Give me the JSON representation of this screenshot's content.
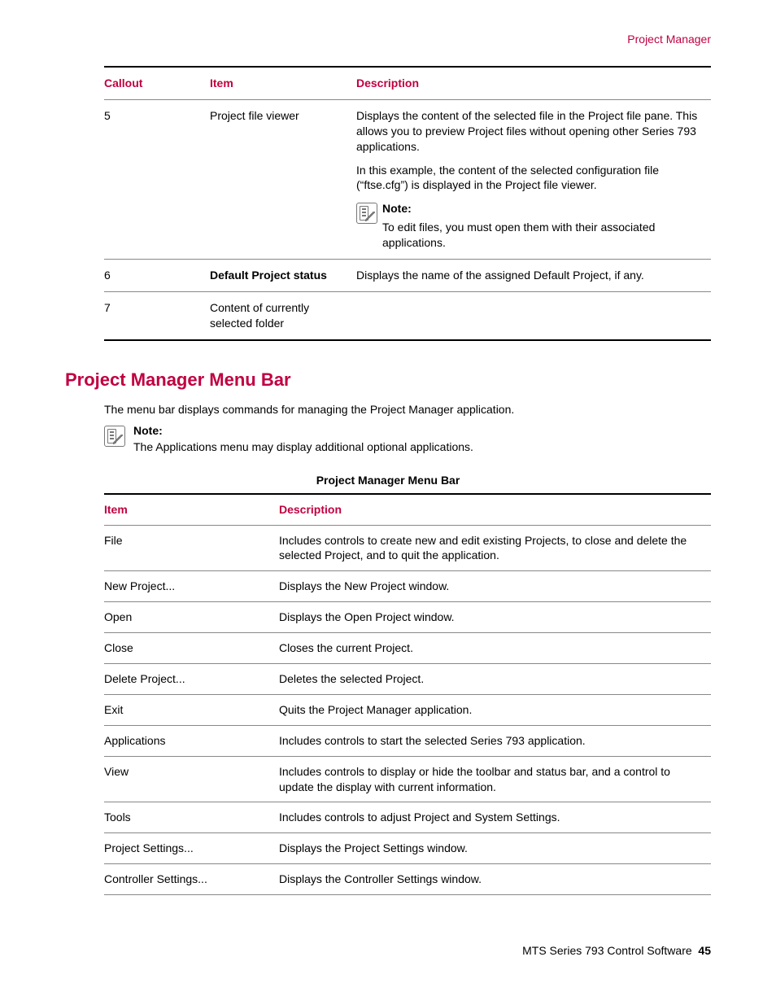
{
  "running_header": "Project Manager",
  "table1": {
    "headers": {
      "callout": "Callout",
      "item": "Item",
      "description": "Description"
    },
    "rows": [
      {
        "callout": "5",
        "item": "Project file viewer",
        "desc_p1": "Displays the content of the selected file in the Project file pane. This allows you to preview Project files without opening other Series 793 applications.",
        "desc_p2": "In this example, the content of the selected configuration file (“ftse.cfg”) is displayed in the Project file viewer.",
        "note_title": "Note:",
        "note_body": "To edit files, you must open them with their associated applications."
      },
      {
        "callout": "6",
        "item": "Default Project status",
        "desc": "Displays the name of the assigned Default Project, if any."
      },
      {
        "callout": "7",
        "item": "Content of currently selected folder",
        "desc": ""
      }
    ]
  },
  "section_heading": "Project Manager Menu Bar",
  "intro_text": "The menu bar displays commands for managing the Project Manager application.",
  "intro_note_title": "Note:",
  "intro_note_body": "The Applications menu may display additional optional applications.",
  "table2_caption": "Project Manager Menu Bar",
  "table2": {
    "headers": {
      "item": "Item",
      "description": "Description"
    },
    "rows": [
      {
        "item": "File",
        "desc": "Includes controls to create new and edit existing Projects, to close and delete the selected Project, and to quit the application."
      },
      {
        "item": "New Project...",
        "desc": "Displays the New Project window."
      },
      {
        "item": "Open",
        "desc": "Displays the Open Project window."
      },
      {
        "item": "Close",
        "desc": "Closes the current Project."
      },
      {
        "item": "Delete Project...",
        "desc": "Deletes the selected Project."
      },
      {
        "item": "Exit",
        "desc": "Quits the Project Manager application."
      },
      {
        "item": "Applications",
        "desc": "Includes controls to start the selected Series 793 application."
      },
      {
        "item": "View",
        "desc": "Includes controls to display or hide the toolbar and status bar, and a control to update the display with current information."
      },
      {
        "item": "Tools",
        "desc": "Includes controls to adjust Project and System Settings."
      },
      {
        "item": "Project Settings...",
        "desc": "Displays the Project Settings window."
      },
      {
        "item": "Controller Settings...",
        "desc": "Displays the Controller Settings window."
      }
    ]
  },
  "footer": {
    "title": "MTS Series 793 Control Software",
    "page": "45"
  }
}
